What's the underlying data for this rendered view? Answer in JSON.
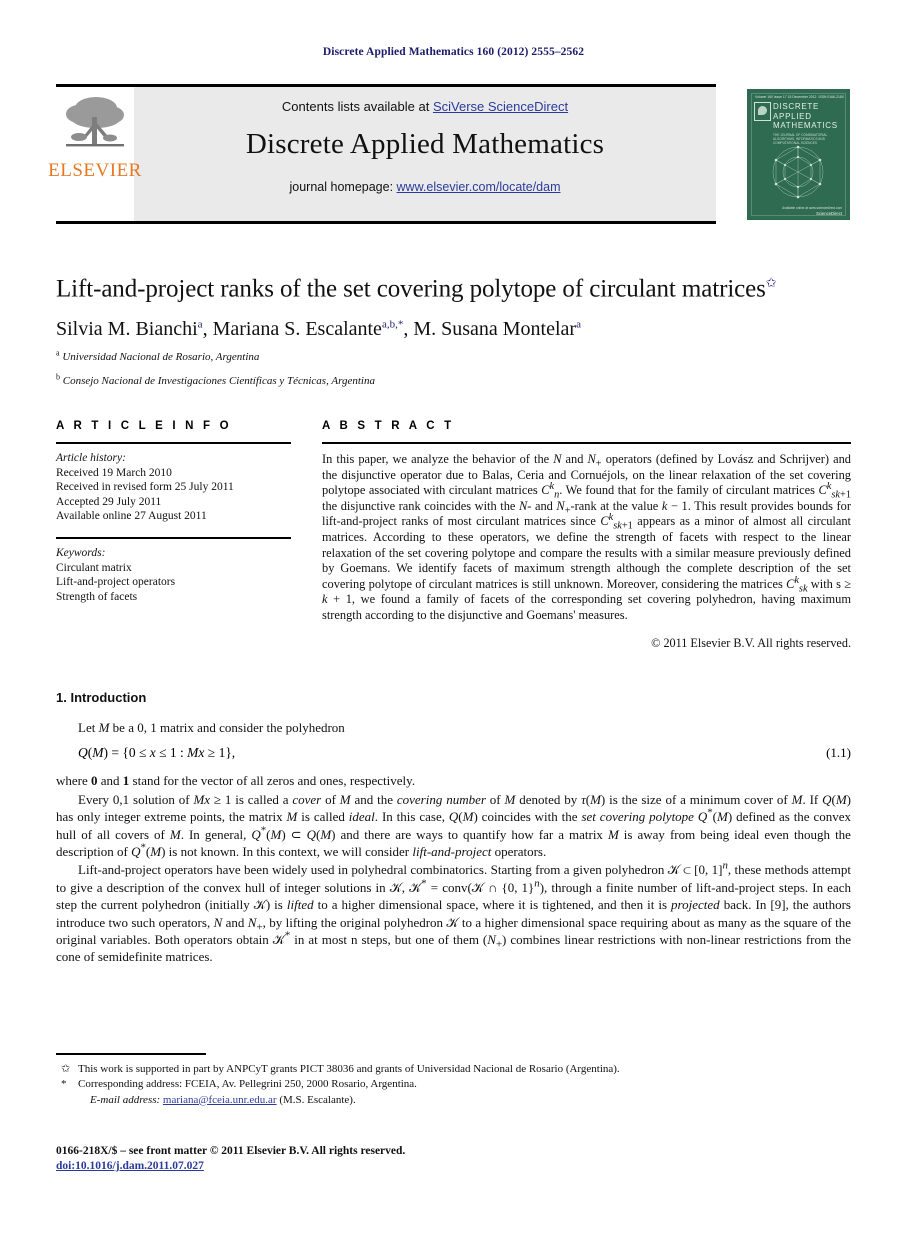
{
  "running_head": "Discrete Applied Mathematics 160 (2012) 2555–2562",
  "masthead": {
    "contents_prefix": "Contents lists available at ",
    "sciencedirect": "SciVerse ScienceDirect",
    "journal_name": "Discrete Applied Mathematics",
    "homepage_prefix": "journal homepage: ",
    "homepage_url": "www.elsevier.com/locate/dam",
    "publisher_logo_text": "ELSEVIER",
    "publisher_logo_icon": "elsevier-tree-icon",
    "accent_link_color": "#2b3a9b",
    "brand_orange": "#E87722",
    "cover": {
      "issue_line_left": "Volume 160  Issue 17  15 December 2012",
      "issue_line_right": "ISSN 0166-218X",
      "title_line1": "DISCRETE",
      "title_line2": "APPLIED",
      "title_line3": "MATHEMATICS",
      "subtitle": "THE JOURNAL OF COMBINATORIAL ALGORITHMS, INFORMATICS AND COMPUTATIONAL SCIENCES",
      "footer_note": "Available online at\nwww.sciencedirect.com",
      "publisher": "ScienceDirect",
      "background_color": "#2e6b50"
    }
  },
  "article": {
    "title": "Lift-and-project ranks of the set covering polytope of circulant matrices",
    "title_footnote_marker": "✩",
    "authors_html": "Silvia M. Bianchi<sup>a</sup>, Mariana S. Escalante<sup>a,b,*</sup>, M. Susana Montelar<sup>a</sup>",
    "affiliations": [
      {
        "marker": "a",
        "text": "Universidad Nacional de Rosario, Argentina"
      },
      {
        "marker": "b",
        "text": "Consejo Nacional de Investigaciones Científicas y Técnicas, Argentina"
      }
    ]
  },
  "article_info": {
    "heading": "A R T I C L E    I N F O",
    "history_label": "Article history:",
    "history": [
      "Received 19 March 2010",
      "Received in revised form 25 July 2011",
      "Accepted 29 July 2011",
      "Available online 27 August 2011"
    ],
    "keywords_label": "Keywords:",
    "keywords": [
      "Circulant matrix",
      "Lift-and-project operators",
      "Strength of facets"
    ]
  },
  "abstract": {
    "heading": "A B S T R A C T",
    "paragraph_html": "In this paper, we analyze the behavior of the <i>N</i> and <i>N</i><sub>+</sub> operators (defined by Lovász and Schrijver) and the disjunctive operator due to Balas, Ceria and Cornuéjols, on the linear relaxation of the set covering polytope associated with circulant matrices <i>C</i><sup><i>k</i></sup><sub><i>n</i></sub>. We found that for the family of circulant matrices <i>C</i><sup><i>k</i></sup><sub><i>sk</i>+1</sub> the disjunctive rank coincides with the <i>N</i>- and <i>N</i><sub>+</sub>-rank at the value <i>k</i> − 1. This result provides bounds for lift-and-project ranks of most circulant matrices since <i>C</i><sup><i>k</i></sup><sub><i>sk</i>+1</sub> appears as a minor of almost all circulant matrices. According to these operators, we define the strength of facets with respect to the linear relaxation of the set covering polytope and compare the results with a similar measure previously defined by Goemans. We identify facets of maximum strength although the complete description of the set covering polytope of circulant matrices is still unknown. Moreover, considering the matrices <i>C</i><sup><i>k</i></sup><sub><i>sk</i></sub> with s ≥ <i>k</i> + 1, we found a family of facets of the corresponding set covering polyhedron, having maximum strength according to the disjunctive and Goemans' measures.",
    "copyright": "© 2011 Elsevier B.V. All rights reserved."
  },
  "body": {
    "section_heading": "1. Introduction",
    "p1_html": "Let <i>M</i> be a 0, 1 matrix and consider the polyhedron",
    "equation_html": "<i>Q</i>(<i>M</i>) = {0 ≤ <i>x</i> ≤ 1 : <i>Mx</i> ≥ 1},",
    "equation_number": "(1.1)",
    "p2_html": "where <b>0</b> and <b>1</b> stand for the vector of all zeros and ones, respectively.",
    "p3_html": "Every 0,1 solution of <i>Mx</i> ≥ 1 is called a <i>cover</i> of <i>M</i> and the <i>covering number</i> of <i>M</i> denoted by <i>τ</i>(<i>M</i>) is the size of a minimum cover of <i>M</i>. If <i>Q</i>(<i>M</i>) has only integer extreme points, the matrix <i>M</i> is called <i>ideal</i>. In this case, <i>Q</i>(<i>M</i>) coincides with the <i>set covering polytope Q</i><sup>*</sup>(<i>M</i>) defined as the convex hull of all covers of <i>M</i>. In general, <i>Q</i><sup>*</sup>(<i>M</i>) ⊂ <i>Q</i>(<i>M</i>) and there are ways to quantify how far a matrix <i>M</i> is away from being ideal even though the description of <i>Q</i><sup>*</sup>(<i>M</i>) is not known. In this context, we will consider <i>lift-and-project</i> operators.",
    "p4_html": "Lift-and-project operators have been widely used in polyhedral combinatorics. Starting from a given polyhedron 𝒦 ⊂ [0, 1]<sup><i>n</i></sup>, these methods attempt to give a description of the convex hull of integer solutions in 𝒦, 𝒦<sup>*</sup> = conv(𝒦 ∩ {0, 1}<sup><i>n</i></sup>), through a finite number of lift-and-project steps. In each step the current polyhedron (initially 𝒦) is <i>lifted</i> to a higher dimensional space, where it is tightened, and then it is <i>projected</i> back. In [9], the authors introduce two such operators, <i>N</i> and <i>N</i><sub>+</sub>, by lifting the original polyhedron 𝒦 to a higher dimensional space requiring about as many as the square of the original variables. Both operators obtain 𝒦<sup>*</sup> in at most n steps, but one of them (<i>N</i><sub>+</sub>) combines linear restrictions with non-linear restrictions from the cone of semidefinite matrices."
  },
  "footnotes": {
    "star_mark": "✩",
    "star_text": "This work is supported in part by ANPCyT grants PICT 38036 and grants of Universidad Nacional de Rosario (Argentina).",
    "corr_mark": "*",
    "corr_text": "Corresponding address: FCEIA, Av. Pellegrini 250, 2000 Rosario, Argentina.",
    "email_label": "E-mail address:",
    "email": "mariana@fceia.unr.edu.ar",
    "email_owner": "(M.S. Escalante)."
  },
  "colophon": {
    "line1": "0166-218X/$ – see front matter © 2011 Elsevier B.V. All rights reserved.",
    "doi": "doi:10.1016/j.dam.2011.07.027"
  }
}
